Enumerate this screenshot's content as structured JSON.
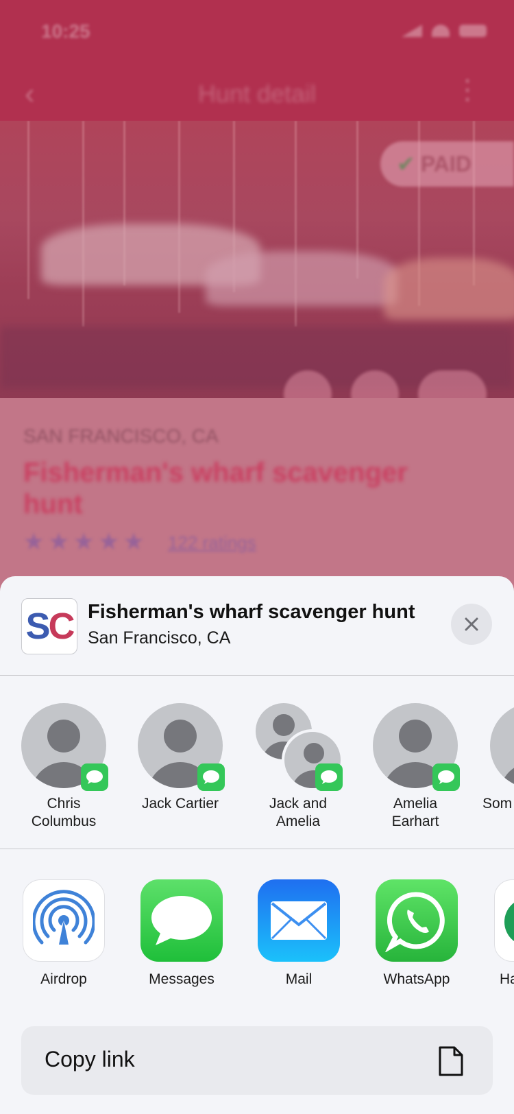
{
  "background": {
    "status_time": "10:25",
    "nav_title": "Hunt detail",
    "paid_label": "PAID",
    "location": "SAN FRANCISCO, CA",
    "title": "Fisherman's wharf scavenger hunt",
    "stars": "★★★★★",
    "ratings": "122 ratings"
  },
  "share": {
    "app_logo": "SC",
    "title": "Fisherman's wharf scavenger hunt",
    "subtitle": "San Francisco, CA",
    "contacts": [
      {
        "line1": "Chris",
        "line2": "Columbus"
      },
      {
        "line1": "Jack Cartier",
        "line2": ""
      },
      {
        "line1": "Jack and",
        "line2": "Amelia"
      },
      {
        "line1": "Amelia",
        "line2": "Earhart"
      },
      {
        "line1": "Som",
        "line2": ""
      }
    ],
    "apps": [
      {
        "label": "Airdrop",
        "icon": "airdrop-icon"
      },
      {
        "label": "Messages",
        "icon": "messages-icon"
      },
      {
        "label": "Mail",
        "icon": "mail-icon"
      },
      {
        "label": "WhatsApp",
        "icon": "whatsapp-icon"
      },
      {
        "label": "Ha",
        "icon": "hangouts-icon"
      }
    ],
    "copy_link_label": "Copy link"
  },
  "colors": {
    "brand": "#b1304f",
    "imessage_green": "#34c759",
    "sheet_bg": "#f4f5f9"
  }
}
